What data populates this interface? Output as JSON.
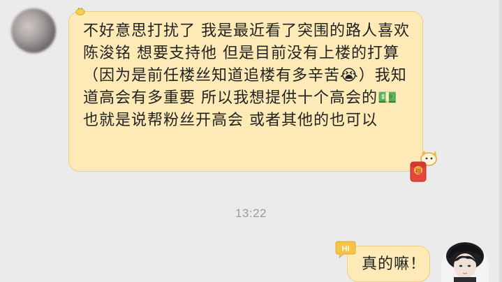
{
  "conversation": {
    "incoming_message": {
      "text": "不好意思打扰了 我是最近看了突围的路人喜欢陈浚铭 想要支持他 但是目前没有上楼的打算（因为是前任楼丝知道追楼有多辛苦😭）我知道高会有多重要 所以我想提供十个高会的💵也就是说帮粉丝开高会 或者其他的也可以",
      "avatar_icon": "blurred-avatar-icon",
      "decorations": [
        "sprout-sticker-icon",
        "red-packet-sticker-icon"
      ]
    },
    "timestamp": "13:22",
    "outgoing_message": {
      "text": "真的嘛！",
      "badge_label": "Hi",
      "avatar_icon": "user-avatar-icon"
    }
  },
  "colors": {
    "background": "#ebebeb",
    "bubble_fill": "#fdeab6",
    "bubble_border": "#efcd84",
    "text": "#222222",
    "timestamp": "#9a9a9a",
    "red_packet": "#e8453c"
  }
}
